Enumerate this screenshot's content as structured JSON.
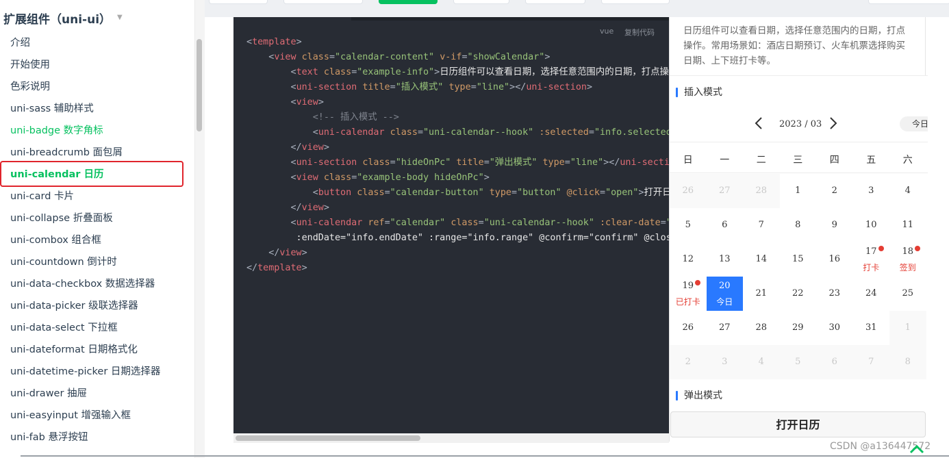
{
  "sidebar": {
    "title": "扩展组件（uni-ui）",
    "items": [
      {
        "label": "介绍"
      },
      {
        "label": "开始使用"
      },
      {
        "label": "色彩说明"
      },
      {
        "label": "uni-sass 辅助样式"
      },
      {
        "label": "uni-badge 数字角标"
      },
      {
        "label": "uni-breadcrumb 面包屑"
      },
      {
        "label": "uni-calendar 日历"
      },
      {
        "label": "uni-card 卡片"
      },
      {
        "label": "uni-collapse 折叠面板"
      },
      {
        "label": "uni-combox 组合框"
      },
      {
        "label": "uni-countdown 倒计时"
      },
      {
        "label": "uni-data-checkbox 数据选择器"
      },
      {
        "label": "uni-data-picker 级联选择器"
      },
      {
        "label": "uni-data-select 下拉框"
      },
      {
        "label": "uni-dateformat 日期格式化"
      },
      {
        "label": "uni-datetime-picker 日期选择器"
      },
      {
        "label": "uni-drawer 抽屉"
      },
      {
        "label": "uni-easyinput 增强输入框"
      },
      {
        "label": "uni-fab 悬浮按钮"
      }
    ],
    "active_index": 6,
    "highlight_index": 4
  },
  "code": {
    "lang": "vue",
    "copy_label": "复制代码",
    "lines": [
      "<template>",
      "    <view class=\"calendar-content\" v-if=\"showCalendar\">",
      "        <text class=\"example-info\">日历组件可以查看日期，选择任意范围内的日期，打点操作。常用场景如：酒店日期预订、火车机票选择购买日期、上下班打卡等。</text>",
      "        <uni-section title=\"插入模式\" type=\"line\"></uni-section>",
      "        <view>",
      "            <!-- 插入模式 -->",
      "            <uni-calendar class=\"uni-calendar--hook\" :selected=\"info.selected\" :showMonth=\"false\" @change=\"change\" @monthSwitch=\"monthSwitch\" />",
      "        </view>",
      "        <uni-section class=\"hideOnPc\" title=\"弹出模式\" type=\"line\"></uni-section>",
      "        <view class=\"example-body hideOnPc\">",
      "            <button class=\"calendar-button\" type=\"button\" @click=\"open\">打开日历</button>",
      "        </view>",
      "        <uni-calendar ref=\"calendar\" class=\"uni-calendar--hook\" :clear-date=\"true\" :date=\"info.date\" :insert=\"info.insert\" :lunar=\"info.lunar\" :startDate=\"info.startDate\"",
      "         :endDate=\"info.endDate\" :range=\"info.range\" @confirm=\"confirm\" @close=\"close\" />",
      "    </view>",
      "</template>"
    ]
  },
  "preview": {
    "info_text": "日历组件可以查看日期，选择任意范围内的日期，打点操作。常用场景如：酒店日期预订、火车机票选择购买日期、上下班打卡等。",
    "section_insert": "插入模式",
    "section_popup": "弹出模式",
    "calendar": {
      "month_label": "2023 / 03",
      "today_label": "今日",
      "weekdays": [
        "日",
        "一",
        "二",
        "三",
        "四",
        "五",
        "六"
      ],
      "weeks": [
        [
          {
            "d": "26",
            "o": true
          },
          {
            "d": "27",
            "o": true
          },
          {
            "d": "28",
            "o": true
          },
          {
            "d": "1"
          },
          {
            "d": "2"
          },
          {
            "d": "3"
          },
          {
            "d": "4"
          }
        ],
        [
          {
            "d": "5"
          },
          {
            "d": "6"
          },
          {
            "d": "7"
          },
          {
            "d": "8"
          },
          {
            "d": "9"
          },
          {
            "d": "10"
          },
          {
            "d": "11"
          }
        ],
        [
          {
            "d": "12"
          },
          {
            "d": "13"
          },
          {
            "d": "14"
          },
          {
            "d": "15"
          },
          {
            "d": "16"
          },
          {
            "d": "17",
            "mark": "打卡",
            "dot": true
          },
          {
            "d": "18",
            "mark": "签到",
            "dot": true
          }
        ],
        [
          {
            "d": "19",
            "mark": "已打卡",
            "dot": true
          },
          {
            "d": "20",
            "mark": "今日",
            "sel": true
          },
          {
            "d": "21"
          },
          {
            "d": "22"
          },
          {
            "d": "23"
          },
          {
            "d": "24"
          },
          {
            "d": "25"
          }
        ],
        [
          {
            "d": "26"
          },
          {
            "d": "27"
          },
          {
            "d": "28"
          },
          {
            "d": "29"
          },
          {
            "d": "30"
          },
          {
            "d": "31"
          },
          {
            "d": "1",
            "o": true
          }
        ],
        [
          {
            "d": "2",
            "o": true
          },
          {
            "d": "3",
            "o": true
          },
          {
            "d": "4",
            "o": true
          },
          {
            "d": "5",
            "o": true
          },
          {
            "d": "6",
            "o": true
          },
          {
            "d": "7",
            "o": true
          },
          {
            "d": "8",
            "o": true
          }
        ]
      ]
    },
    "open_button": "打开日历"
  },
  "footer": {
    "watermark": "CSDN @a136447572"
  },
  "colors": {
    "accent": "#07c160",
    "highlight_border": "#e0242c",
    "selected_day": "#2979ff",
    "mark_red": "#e43d33",
    "code_bg": "#282c34"
  },
  "icons": {
    "prev": "chevron-left-icon",
    "next": "chevron-right-icon",
    "back_to_top": "chevron-up-icon"
  }
}
